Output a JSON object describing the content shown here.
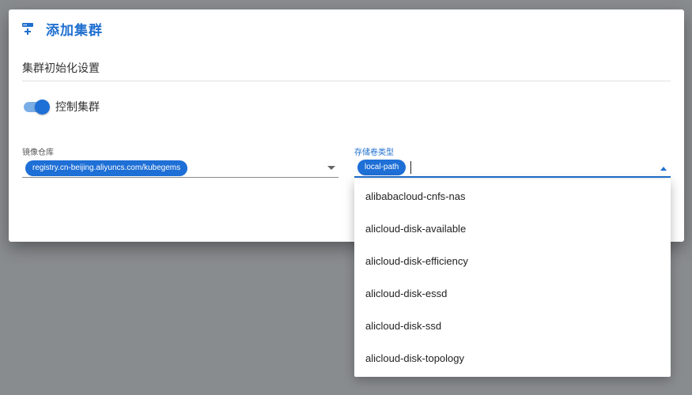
{
  "dialog": {
    "title": "添加集群",
    "icon": "add-server-icon",
    "accent_color": "#1f6fcf"
  },
  "section": {
    "title": "集群初始化设置"
  },
  "toggle": {
    "label": "控制集群",
    "on": true
  },
  "registry_field": {
    "label": "镜像仓库",
    "chips": [
      "registry.cn-beijing.aliyuncs.com/kubegems"
    ]
  },
  "storage_field": {
    "label": "存储卷类型",
    "chips": [
      "local-path"
    ],
    "options": [
      "alibabacloud-cnfs-nas",
      "alicloud-disk-available",
      "alicloud-disk-efficiency",
      "alicloud-disk-essd",
      "alicloud-disk-ssd",
      "alicloud-disk-topology"
    ]
  }
}
